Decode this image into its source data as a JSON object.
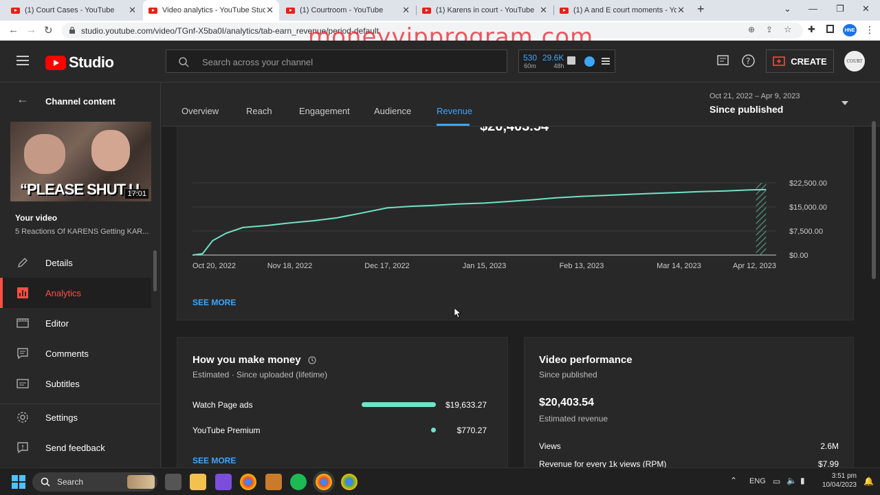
{
  "browser": {
    "tabs": [
      {
        "label": "(1) Court Cases - YouTube",
        "active": false
      },
      {
        "label": "Video analytics - YouTube Studio",
        "active": true
      },
      {
        "label": "(1) Courtroom - YouTube",
        "active": false
      },
      {
        "label": "(1) Karens in court - YouTube",
        "active": false
      },
      {
        "label": "(1) A and E court moments - You",
        "active": false
      }
    ],
    "url": "studio.youtube.com/video/TGnf-X5ba0I/analytics/tab-earn_revenue/period-default",
    "watermark": "moneyvipprogram.com",
    "profile_badge": "HNE"
  },
  "header": {
    "logo_text": "Studio",
    "search_placeholder": "Search across your channel",
    "realtime": [
      {
        "value": "530",
        "label": "60m"
      },
      {
        "value": "29.6K",
        "label": "48h"
      }
    ],
    "create_label": "CREATE",
    "avatar_text": "COURT"
  },
  "sidebar": {
    "back_label": "Channel content",
    "thumbnail_text": "“PLEASE SHUT U",
    "thumbnail_duration": "17:01",
    "your_video_label": "Your video",
    "video_title": "5 Reactions Of KARENS Getting KAR...",
    "items": [
      {
        "label": "Details",
        "icon": "pencil-icon",
        "active": false
      },
      {
        "label": "Analytics",
        "icon": "analytics-icon",
        "active": true
      },
      {
        "label": "Editor",
        "icon": "film-icon",
        "active": false
      },
      {
        "label": "Comments",
        "icon": "comment-icon",
        "active": false
      },
      {
        "label": "Subtitles",
        "icon": "subtitles-icon",
        "active": false
      },
      {
        "label": "Settings",
        "icon": "gear-icon",
        "active": false
      },
      {
        "label": "Send feedback",
        "icon": "feedback-icon",
        "active": false
      }
    ]
  },
  "analytics": {
    "tabs": [
      "Overview",
      "Reach",
      "Engagement",
      "Audience",
      "Revenue"
    ],
    "active_tab": "Revenue",
    "date_range": "Oct 21, 2022 – Apr 9, 2023",
    "period_label": "Since published",
    "headline_partial": "$20,403.54",
    "see_more": "SEE MORE"
  },
  "chart_data": {
    "type": "line",
    "title": "",
    "xlabel": "",
    "ylabel": "",
    "x_ticks": [
      "Oct 20, 2022",
      "Nov 18, 2022",
      "Dec 17, 2022",
      "Jan 15, 2023",
      "Feb 13, 2023",
      "Mar 14, 2023",
      "Apr 12, 2023"
    ],
    "y_ticks": [
      "$0.00",
      "$7,500.00",
      "$15,000.00",
      "$22,500.00"
    ],
    "ylim": [
      0,
      22500
    ],
    "x": [
      "2022-10-20",
      "2022-10-23",
      "2022-10-26",
      "2022-10-30",
      "2022-11-04",
      "2022-11-11",
      "2022-11-18",
      "2022-11-25",
      "2022-12-02",
      "2022-12-09",
      "2022-12-17",
      "2022-12-24",
      "2022-12-31",
      "2023-01-07",
      "2023-01-15",
      "2023-01-22",
      "2023-01-29",
      "2023-02-05",
      "2023-02-13",
      "2023-02-20",
      "2023-02-27",
      "2023-03-06",
      "2023-03-14",
      "2023-03-21",
      "2023-03-28",
      "2023-04-04",
      "2023-04-09"
    ],
    "series": [
      {
        "values": [
          0,
          400,
          4500,
          6800,
          8600,
          9200,
          10000,
          10700,
          11600,
          13000,
          14700,
          15200,
          15500,
          15900,
          16200,
          16700,
          17200,
          17800,
          18300,
          18600,
          18900,
          19200,
          19500,
          19800,
          20000,
          20300,
          20403
        ]
      }
    ],
    "color": "#6fe4c8",
    "grid": true,
    "shaded_region": "Apr 6, 2023 – Apr 9, 2023"
  },
  "money": {
    "title": "How you make money",
    "subtitle": "Estimated · Since uploaded (lifetime)",
    "rows": [
      {
        "label": "Watch Page ads",
        "value": "$19,633.27",
        "fraction": 0.962
      },
      {
        "label": "YouTube Premium",
        "value": "$770.27",
        "fraction": 0.038
      }
    ],
    "see_more": "SEE MORE"
  },
  "performance": {
    "title": "Video performance",
    "subtitle": "Since published",
    "revenue": "$20,403.54",
    "revenue_label": "Estimated revenue",
    "rows": [
      {
        "label": "Views",
        "value": "2.6M"
      },
      {
        "label": "Revenue for every 1k views (RPM)",
        "value": "$7.99"
      }
    ]
  },
  "taskbar": {
    "search_label": "Search",
    "language": "ENG",
    "time": "3:51 pm",
    "date": "10/04/2023"
  }
}
